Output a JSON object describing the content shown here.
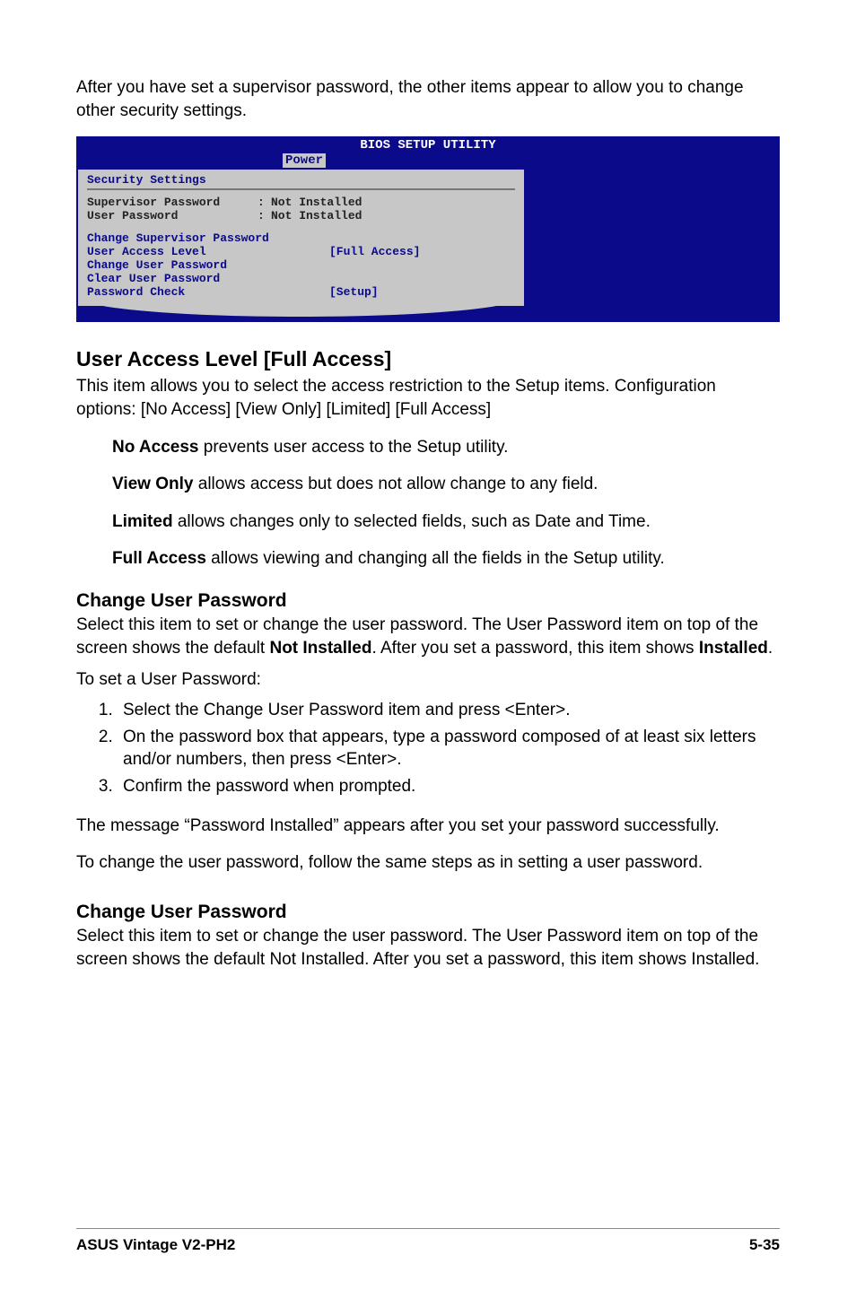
{
  "intro": "After you have set a supervisor password, the other items appear to allow you to change other security settings.",
  "bios": {
    "title": "BIOS SETUP UTILITY",
    "active_tab": "Power",
    "section_title": "Security Settings",
    "status": [
      {
        "label": "Supervisor Password",
        "value": "Not Installed"
      },
      {
        "label": "User Password",
        "value": "Not Installed"
      }
    ],
    "options": [
      {
        "label": "Change Supervisor Password",
        "value": ""
      },
      {
        "label": "User Access Level",
        "value": "[Full Access]"
      },
      {
        "label": "Change User Password",
        "value": ""
      },
      {
        "label": "Clear User Password",
        "value": ""
      },
      {
        "label": "Password Check",
        "value": "[Setup]"
      }
    ]
  },
  "ual": {
    "heading": "User Access Level [Full Access]",
    "desc": "This item allows you to select the access restriction to the Setup items. Configuration options: [No Access] [View Only] [Limited] [Full Access]",
    "opts": {
      "no_access_b": "No Access",
      "no_access_t": " prevents user access to the Setup utility.",
      "view_only_b": "View Only",
      "view_only_t": " allows access but does not allow change to any field.",
      "limited_b": "Limited",
      "limited_t": " allows changes only to selected fields, such as Date and Time.",
      "full_access_b": "Full Access",
      "full_access_t": " allows viewing and changing all the fields in the Setup utility."
    }
  },
  "cup1": {
    "heading": "Change User Password",
    "p1a": "Select this item to set or change the user password. The User Password item on top of the screen shows the default ",
    "p1b": "Not Installed",
    "p1c": ". After you set a password, this item shows ",
    "p1d": "Installed",
    "p1e": ".",
    "p2": "To set a User Password:",
    "steps": [
      "Select the Change User Password item and press <Enter>.",
      "On the password box that appears, type a password composed of at least six letters and/or numbers, then press <Enter>.",
      "Confirm the password when prompted."
    ],
    "p3": "The message “Password Installed” appears after you set your password successfully.",
    "p4": "To change the user password, follow the same steps as in setting a user password."
  },
  "cup2": {
    "heading": "Change User Password",
    "p1": "Select this item to set or change the user password. The User Password item on top of the screen shows the default Not Installed. After you set a password, this item shows Installed."
  },
  "footer": {
    "left": "ASUS Vintage V2-PH2",
    "right": "5-35"
  }
}
